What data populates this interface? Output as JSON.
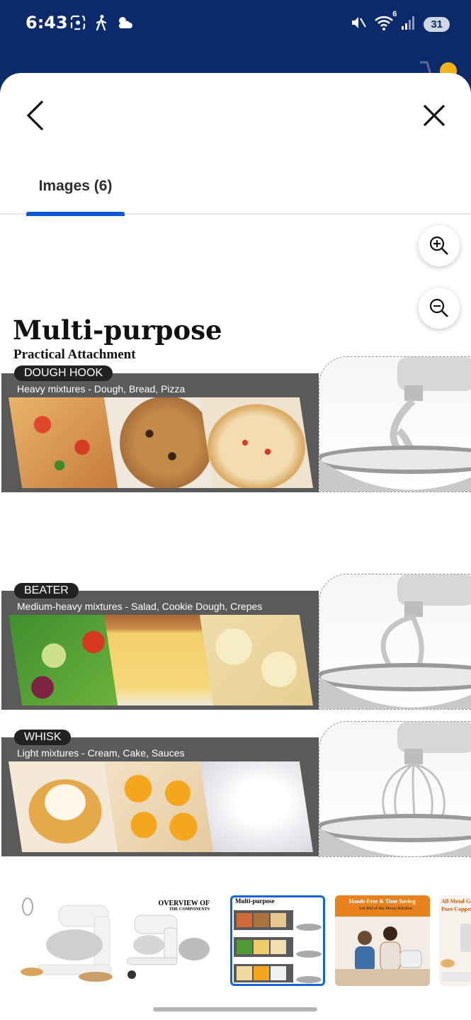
{
  "status_bar": {
    "time": "6:43",
    "battery": "31",
    "wifi_badge": "6",
    "icons_left": [
      "screenshot-icon",
      "walking-icon",
      "weather-icon"
    ],
    "icons_right": [
      "mute-icon",
      "wifi-icon",
      "signal-icon",
      "battery-icon"
    ]
  },
  "header": {
    "back_icon": "chevron-left-icon",
    "close_icon": "close-icon"
  },
  "tabs": [
    {
      "label": "Images (6)",
      "selected": true
    }
  ],
  "zoom": {
    "in_icon": "zoom-in-icon",
    "out_icon": "zoom-out-icon"
  },
  "image": {
    "title": "Multi-purpose",
    "subtitle": "Practical Attachment",
    "sections": [
      {
        "name": "DOUGH HOOK",
        "desc": "Heavy mixtures - Dough, Bread, Pizza",
        "photos": [
          "pizza",
          "cookies",
          "bread"
        ]
      },
      {
        "name": "BEATER",
        "desc": "Medium-heavy mixtures - Salad, Cookie Dough, Crepes",
        "photos": [
          "salad",
          "cake",
          "mashed-potatoes"
        ]
      },
      {
        "name": "WHISK",
        "desc": "Light mixtures - Cream, Cake, Sauces",
        "photos": [
          "cream-puff",
          "egg-yolks",
          "whipped-cream"
        ]
      }
    ]
  },
  "thumbnails": [
    {
      "id": "thumb-1",
      "caption": "",
      "active": false
    },
    {
      "id": "thumb-2",
      "caption": "OVERVIEW OF",
      "caption2": "THE COMPONENTS",
      "active": false
    },
    {
      "id": "thumb-3",
      "caption": "Multi-purpose",
      "active": true
    },
    {
      "id": "thumb-4",
      "caption": "Hands-Free & Time Saving",
      "caption2": "Let Rid of the Messy Kitchen",
      "active": false
    },
    {
      "id": "thumb-5",
      "caption": "All-Metal Gea",
      "caption2": "Pure Copper I",
      "active": false
    }
  ],
  "colors": {
    "header_bg": "#0a2a6b",
    "tab_indicator": "#0b5ad8",
    "band_bg": "#5a5a5a",
    "pill_bg": "#222222",
    "thumb_active": "#1565d8",
    "thumb_orange": "#e8821e"
  }
}
